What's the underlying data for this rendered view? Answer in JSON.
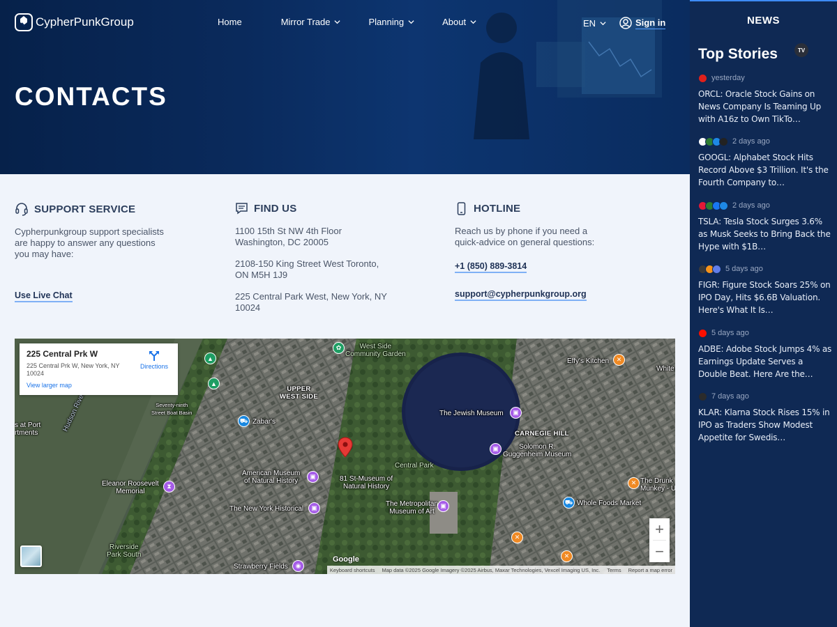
{
  "header": {
    "brand": "CypherPunkGroup",
    "nav": [
      {
        "label": "Home",
        "dropdown": false
      },
      {
        "label": "Mirror Trade",
        "dropdown": true
      },
      {
        "label": "Planning",
        "dropdown": true
      },
      {
        "label": "About",
        "dropdown": true
      }
    ],
    "language": "EN",
    "sign_in": "Sign in",
    "page_title": "CONTACTS"
  },
  "support": {
    "heading": "SUPPORT SERVICE",
    "text": "Cypherpunkgroup support specialists are happy to answer any questions you may have:",
    "link": "Use Live Chat"
  },
  "find_us": {
    "heading": "FIND US",
    "addresses": [
      "1100 15th St NW 4th Floor Washington, DC 20005",
      "2108-150 King Street West Toronto, ON M5H 1J9",
      "225 Central Park West, New York, NY 10024"
    ]
  },
  "hotline": {
    "heading": "HOTLINE",
    "text": "Reach us by phone if you need a quick-advice on general questions:",
    "phone": "+1 (850) 889-3814",
    "email": "support@cypherpunkgroup.org"
  },
  "map": {
    "place_title": "225 Central Prk W",
    "place_address": "225 Central Prk W, New York, NY 10024",
    "directions": "Directions",
    "view_larger": "View larger map",
    "zoom_in": "+",
    "zoom_out": "−",
    "google": "Google",
    "attribution": [
      "Keyboard shortcuts",
      "Map data ©2025 Google Imagery ©2025 Airbus, Maxar Technologies, Vexcel Imaging US, Inc.",
      "Terms",
      "Report a map error"
    ],
    "labels": {
      "uws": "UPPER\nWEST SIDE",
      "carnegie": "CARNEGIE HILL",
      "jewish": "The Jewish Museum",
      "guggenheim": "Solomon R.\nGuggenheim Museum",
      "amnh": "American Museum\nof Natural History",
      "amnh2": "81 St-Museum of\nNatural History",
      "met": "The Metropolitan\nMuseum of Art",
      "nyhist": "The New York Historical",
      "eleanor": "Eleanor Roosevelt\nMemorial",
      "zabars": "Zabar's",
      "wholefoods": "Whole Foods Market",
      "efty": "Effy's Kitchen",
      "garden": "West Side\nCommunity Garden",
      "strawberry": "Strawberry Fields",
      "riverside": "Riverside\nPark South",
      "boat": "Seventy-ninth\nStreet Boat Basin",
      "centralpark": "Central Park",
      "port": "s at Port\nrtments",
      "hudson": "Hudson River",
      "drunken": "The Drunk\nMunkey - U",
      "white": "White"
    }
  },
  "news": {
    "heading": "NEWS",
    "subheading": "Top Stories",
    "badge": "TV",
    "stories": [
      {
        "time": "yesterday",
        "title": "ORCL: Oracle Stock Gains on News Company Is Teaming Up with A16z to Own TikTo…",
        "logos": [
          "#e0201b"
        ]
      },
      {
        "time": "2 days ago",
        "title": "GOOGL: Alphabet Stock Hits Record Above $3 Trillion. It's the Fourth Company to…",
        "logos": [
          "#ffffff",
          "#2e7d32",
          "#1e88e5",
          "#222222"
        ]
      },
      {
        "time": "2 days ago",
        "title": "TSLA: Tesla Stock Surges 3.6% as Musk Seeks to Bring Back the Hype with $1B…",
        "logos": [
          "#e31937",
          "#2e7d32",
          "#1877f2",
          "#1e88e5"
        ]
      },
      {
        "time": "5 days ago",
        "title": "FIGR: Figure Stock Soars 25% on IPO Day, Hits $6.6B Valuation. Here's What It Is…",
        "logos": [
          "#3a3a3a",
          "#f7931a",
          "#627eea"
        ]
      },
      {
        "time": "5 days ago",
        "title": "ADBE: Adobe Stock Jumps 4% as Earnings Update Serves a Double Beat. Here Are the…",
        "logos": [
          "#fa0f00"
        ]
      },
      {
        "time": "7 days ago",
        "title": "KLAR: Klarna Stock Rises 15% in IPO as Traders Show Modest Appetite for Swedis…",
        "logos": [
          "#2b2b2b"
        ]
      }
    ]
  },
  "colors": {
    "hero_bg": "#0a2a5c",
    "news_bg": "#0f2954",
    "accent": "#3e8bf5",
    "page_bg": "#f0f4fb"
  }
}
